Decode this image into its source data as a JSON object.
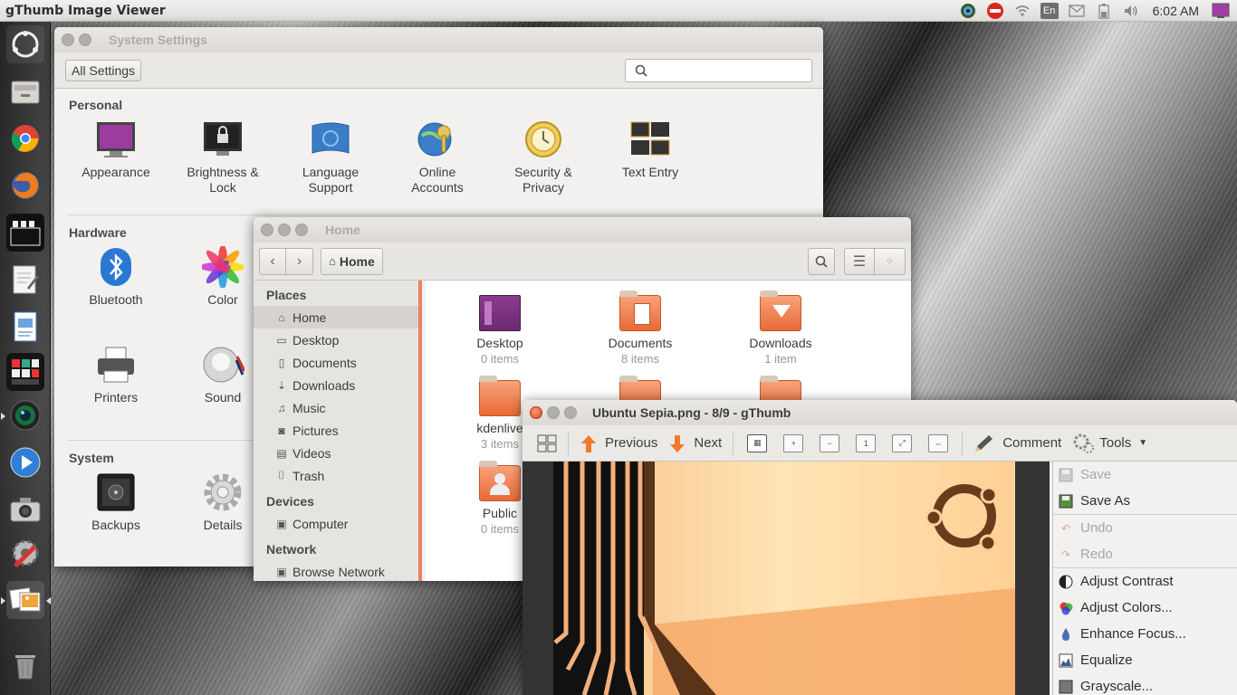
{
  "panel": {
    "app_title": "gThumb Image Viewer",
    "keyboard": "En",
    "clock": "6:02 AM"
  },
  "settings": {
    "title": "System Settings",
    "all_settings": "All Settings",
    "sections": {
      "personal": "Personal",
      "hardware": "Hardware",
      "system": "System"
    },
    "personal": [
      {
        "l1": "Appearance",
        "l2": ""
      },
      {
        "l1": "Brightness &",
        "l2": "Lock"
      },
      {
        "l1": "Language",
        "l2": "Support"
      },
      {
        "l1": "Online",
        "l2": "Accounts"
      },
      {
        "l1": "Security &",
        "l2": "Privacy"
      },
      {
        "l1": "Text Entry",
        "l2": ""
      }
    ],
    "hardware": [
      "Bluetooth",
      "Color",
      "Printers",
      "Sound"
    ],
    "system": [
      "Backups",
      "Details"
    ]
  },
  "files": {
    "title": "Home",
    "path": "Home",
    "places_header": "Places",
    "places": [
      "Home",
      "Desktop",
      "Documents",
      "Downloads",
      "Music",
      "Pictures",
      "Videos",
      "Trash"
    ],
    "devices_header": "Devices",
    "devices": [
      "Computer"
    ],
    "network_header": "Network",
    "network": [
      "Browse Network"
    ],
    "items": [
      {
        "name": "Desktop",
        "count": "0 items"
      },
      {
        "name": "Documents",
        "count": "8 items"
      },
      {
        "name": "Downloads",
        "count": "1 item"
      },
      {
        "name": "kdenlive",
        "count": "3 items"
      },
      {
        "name": "Public",
        "count": "0 items"
      }
    ]
  },
  "gthumb": {
    "title": "Ubuntu Sepia.png - 8/9 - gThumb",
    "previous": "Previous",
    "next": "Next",
    "comment": "Comment",
    "tools": "Tools",
    "menu": [
      {
        "label": "Save",
        "enabled": false
      },
      {
        "label": "Save As",
        "enabled": true
      },
      {
        "label": "Undo",
        "enabled": false
      },
      {
        "label": "Redo",
        "enabled": false
      },
      {
        "label": "Adjust Contrast",
        "enabled": true
      },
      {
        "label": "Adjust Colors...",
        "enabled": true
      },
      {
        "label": "Enhance Focus...",
        "enabled": true
      },
      {
        "label": "Equalize",
        "enabled": true
      },
      {
        "label": "Grayscale...",
        "enabled": true
      }
    ]
  },
  "colors": {
    "accent": "#e9825f",
    "close": "#df4a16",
    "launcher": "#2a2a2a",
    "panel": "#e8e6e3"
  }
}
